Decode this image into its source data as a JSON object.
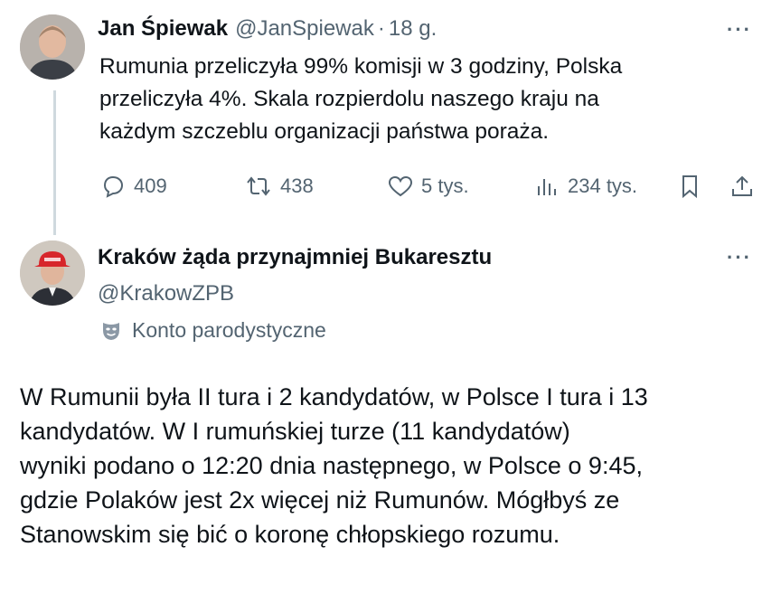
{
  "tweet1": {
    "name": "Jan Śpiewak",
    "handle": "@JanSpiewak",
    "dot": "·",
    "time": "18 g.",
    "more": "···",
    "text_lines": [
      "Rumunia przeliczyła 99% komisji w 3 godziny, Polska",
      "przeliczyła 4%. Skala rozpierdolu naszego kraju na",
      "każdym szczeblu organizacji państwa poraża."
    ],
    "actions": {
      "replies": "409",
      "reposts": "438",
      "likes": "5 tys.",
      "views": "234 tys."
    }
  },
  "tweet2": {
    "name": "Kraków żąda przynajmniej Bukaresztu",
    "handle": "@KrakowZPB",
    "more": "···",
    "label": "Konto parodystyczne",
    "text_lines": [
      "W Rumunii była II tura i 2 kandydatów, w Polsce I tura i 13",
      "kandydatów. W I rumuńskiej turze (11 kandydatów)",
      "wyniki podano o 12:20 dnia następnego, w Polsce o 9:45,",
      "gdzie Polaków jest 2x więcej niż Rumunów. Mógłbyś ze",
      "Stanowskim się bić o koronę chłopskiego rozumu."
    ]
  }
}
